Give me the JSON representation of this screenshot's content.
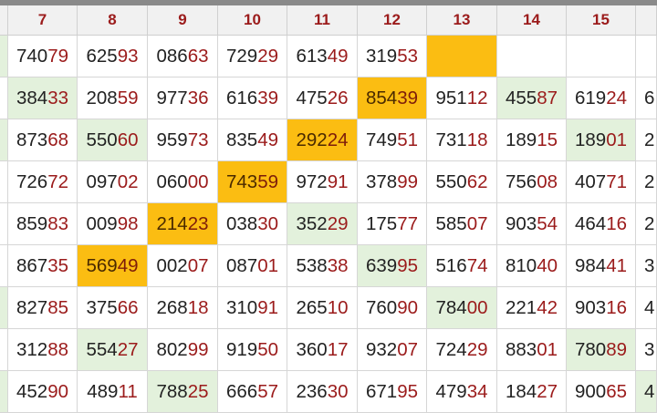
{
  "headers": [
    "",
    "7",
    "8",
    "9",
    "10",
    "11",
    "12",
    "13",
    "14",
    "15",
    ""
  ],
  "rows": [
    [
      {
        "p": "",
        "s": "",
        "h": "green"
      },
      {
        "p": "740",
        "s": "79",
        "h": ""
      },
      {
        "p": "625",
        "s": "93",
        "h": ""
      },
      {
        "p": "086",
        "s": "63",
        "h": ""
      },
      {
        "p": "729",
        "s": "29",
        "h": ""
      },
      {
        "p": "613",
        "s": "49",
        "h": ""
      },
      {
        "p": "319",
        "s": "53",
        "h": ""
      },
      {
        "p": "",
        "s": "",
        "h": "orange"
      },
      {
        "p": "",
        "s": "",
        "h": ""
      },
      {
        "p": "",
        "s": "",
        "h": ""
      },
      {
        "p": "",
        "s": "",
        "h": ""
      }
    ],
    [
      {
        "p": "",
        "s": "",
        "h": ""
      },
      {
        "p": "384",
        "s": "33",
        "h": "green"
      },
      {
        "p": "208",
        "s": "59",
        "h": ""
      },
      {
        "p": "977",
        "s": "36",
        "h": ""
      },
      {
        "p": "616",
        "s": "39",
        "h": ""
      },
      {
        "p": "475",
        "s": "26",
        "h": ""
      },
      {
        "p": "854",
        "s": "39",
        "h": "orange"
      },
      {
        "p": "951",
        "s": "12",
        "h": ""
      },
      {
        "p": "455",
        "s": "87",
        "h": "green"
      },
      {
        "p": "619",
        "s": "24",
        "h": ""
      },
      {
        "p": "6",
        "s": "",
        "h": ""
      }
    ],
    [
      {
        "p": "",
        "s": "",
        "h": "green"
      },
      {
        "p": "873",
        "s": "68",
        "h": ""
      },
      {
        "p": "550",
        "s": "60",
        "h": "green"
      },
      {
        "p": "959",
        "s": "73",
        "h": ""
      },
      {
        "p": "835",
        "s": "49",
        "h": ""
      },
      {
        "p": "292",
        "s": "24",
        "h": "orange"
      },
      {
        "p": "749",
        "s": "51",
        "h": ""
      },
      {
        "p": "731",
        "s": "18",
        "h": ""
      },
      {
        "p": "189",
        "s": "15",
        "h": ""
      },
      {
        "p": "189",
        "s": "01",
        "h": "green"
      },
      {
        "p": "2",
        "s": "",
        "h": ""
      }
    ],
    [
      {
        "p": "",
        "s": "",
        "h": ""
      },
      {
        "p": "726",
        "s": "72",
        "h": ""
      },
      {
        "p": "097",
        "s": "02",
        "h": ""
      },
      {
        "p": "060",
        "s": "00",
        "h": ""
      },
      {
        "p": "743",
        "s": "59",
        "h": "orange"
      },
      {
        "p": "972",
        "s": "91",
        "h": ""
      },
      {
        "p": "378",
        "s": "99",
        "h": ""
      },
      {
        "p": "550",
        "s": "62",
        "h": ""
      },
      {
        "p": "756",
        "s": "08",
        "h": ""
      },
      {
        "p": "407",
        "s": "71",
        "h": ""
      },
      {
        "p": "2",
        "s": "",
        "h": ""
      }
    ],
    [
      {
        "p": "",
        "s": "",
        "h": ""
      },
      {
        "p": "859",
        "s": "83",
        "h": ""
      },
      {
        "p": "009",
        "s": "98",
        "h": ""
      },
      {
        "p": "214",
        "s": "23",
        "h": "orange"
      },
      {
        "p": "038",
        "s": "30",
        "h": ""
      },
      {
        "p": "352",
        "s": "29",
        "h": "green"
      },
      {
        "p": "175",
        "s": "77",
        "h": ""
      },
      {
        "p": "585",
        "s": "07",
        "h": ""
      },
      {
        "p": "903",
        "s": "54",
        "h": ""
      },
      {
        "p": "464",
        "s": "16",
        "h": ""
      },
      {
        "p": "2",
        "s": "",
        "h": ""
      }
    ],
    [
      {
        "p": "",
        "s": "",
        "h": ""
      },
      {
        "p": "867",
        "s": "35",
        "h": ""
      },
      {
        "p": "569",
        "s": "49",
        "h": "orange"
      },
      {
        "p": "002",
        "s": "07",
        "h": ""
      },
      {
        "p": "087",
        "s": "01",
        "h": ""
      },
      {
        "p": "538",
        "s": "38",
        "h": ""
      },
      {
        "p": "639",
        "s": "95",
        "h": "green"
      },
      {
        "p": "516",
        "s": "74",
        "h": ""
      },
      {
        "p": "810",
        "s": "40",
        "h": ""
      },
      {
        "p": "984",
        "s": "41",
        "h": ""
      },
      {
        "p": "3",
        "s": "",
        "h": ""
      }
    ],
    [
      {
        "p": "",
        "s": "",
        "h": "green"
      },
      {
        "p": "827",
        "s": "85",
        "h": ""
      },
      {
        "p": "375",
        "s": "66",
        "h": ""
      },
      {
        "p": "268",
        "s": "18",
        "h": ""
      },
      {
        "p": "310",
        "s": "91",
        "h": ""
      },
      {
        "p": "265",
        "s": "10",
        "h": ""
      },
      {
        "p": "760",
        "s": "90",
        "h": ""
      },
      {
        "p": "784",
        "s": "00",
        "h": "green"
      },
      {
        "p": "221",
        "s": "42",
        "h": ""
      },
      {
        "p": "903",
        "s": "16",
        "h": ""
      },
      {
        "p": "4",
        "s": "",
        "h": ""
      }
    ],
    [
      {
        "p": "",
        "s": "",
        "h": ""
      },
      {
        "p": "312",
        "s": "88",
        "h": ""
      },
      {
        "p": "554",
        "s": "27",
        "h": "green"
      },
      {
        "p": "802",
        "s": "99",
        "h": ""
      },
      {
        "p": "919",
        "s": "50",
        "h": ""
      },
      {
        "p": "360",
        "s": "17",
        "h": ""
      },
      {
        "p": "932",
        "s": "07",
        "h": ""
      },
      {
        "p": "724",
        "s": "29",
        "h": ""
      },
      {
        "p": "883",
        "s": "01",
        "h": ""
      },
      {
        "p": "780",
        "s": "89",
        "h": "green"
      },
      {
        "p": "3",
        "s": "",
        "h": ""
      }
    ],
    [
      {
        "p": "",
        "s": "",
        "h": "green"
      },
      {
        "p": "452",
        "s": "90",
        "h": ""
      },
      {
        "p": "489",
        "s": "11",
        "h": ""
      },
      {
        "p": "788",
        "s": "25",
        "h": "green"
      },
      {
        "p": "666",
        "s": "57",
        "h": ""
      },
      {
        "p": "236",
        "s": "30",
        "h": ""
      },
      {
        "p": "671",
        "s": "95",
        "h": ""
      },
      {
        "p": "479",
        "s": "34",
        "h": ""
      },
      {
        "p": "184",
        "s": "27",
        "h": ""
      },
      {
        "p": "900",
        "s": "65",
        "h": ""
      },
      {
        "p": "4",
        "s": "",
        "h": "green"
      }
    ]
  ],
  "colors": {
    "highlight_green": "#e3f1dc",
    "highlight_orange": "#fbbd12",
    "suffix_red": "#9b1b1b"
  }
}
